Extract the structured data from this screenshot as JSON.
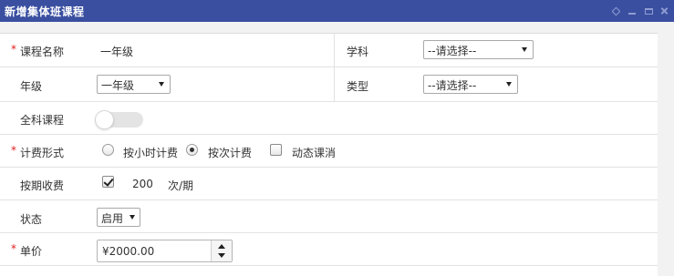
{
  "window": {
    "title": "新增集体班课程"
  },
  "form": {
    "course_name": {
      "label": "课程名称",
      "required_mark": "*",
      "value": "一年级"
    },
    "subject": {
      "label": "学科",
      "selected": "--请选择--"
    },
    "grade": {
      "label": "年级",
      "selected": "一年级"
    },
    "type": {
      "label": "类型",
      "selected": "--请选择--"
    },
    "all_subjects": {
      "label": "全科课程",
      "on": false
    },
    "billing": {
      "label": "计费形式",
      "required_mark": "*",
      "options": [
        {
          "label": "按小时计费",
          "selected": false
        },
        {
          "label": "按次计费",
          "selected": true
        },
        {
          "label": "动态课消",
          "checked": false
        }
      ]
    },
    "period_fee": {
      "label": "按期收费",
      "checked": true,
      "value": "200",
      "unit": "次/期"
    },
    "status": {
      "label": "状态",
      "selected": "启用"
    },
    "unit_price": {
      "label": "单价",
      "required_mark": "*",
      "value": "¥2000.00"
    }
  },
  "colors": {
    "titlebar": "#3a4fa0",
    "required": "#e02020"
  }
}
